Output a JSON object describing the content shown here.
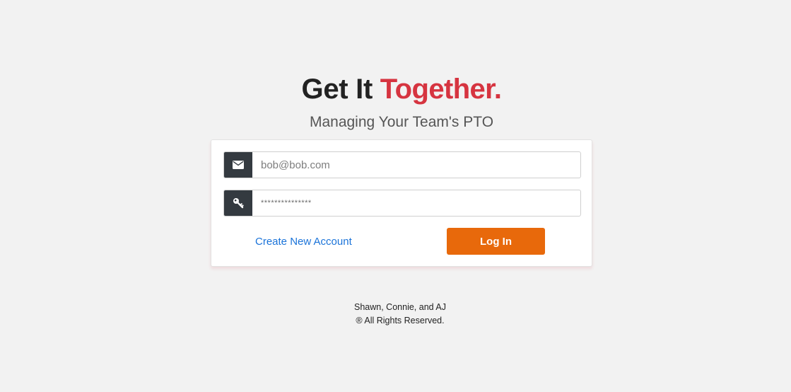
{
  "header": {
    "headline_plain": "Get It ",
    "headline_accent": "Together.",
    "subtitle": "Managing Your Team's PTO"
  },
  "login_form": {
    "email": {
      "icon": "envelope-icon",
      "placeholder": "bob@bob.com",
      "value": ""
    },
    "password": {
      "icon": "key-icon",
      "value": "***************"
    },
    "create_account_label": "Create New Account",
    "login_label": "Log In"
  },
  "footer": {
    "line1": "Shawn, Connie, and AJ",
    "line2": "® All Rights Reserved."
  },
  "colors": {
    "background": "#f2f2f2",
    "accent_red": "#d63440",
    "login_button": "#e8690b",
    "link_blue": "#1a73d9",
    "icon_addon": "#343a40"
  }
}
